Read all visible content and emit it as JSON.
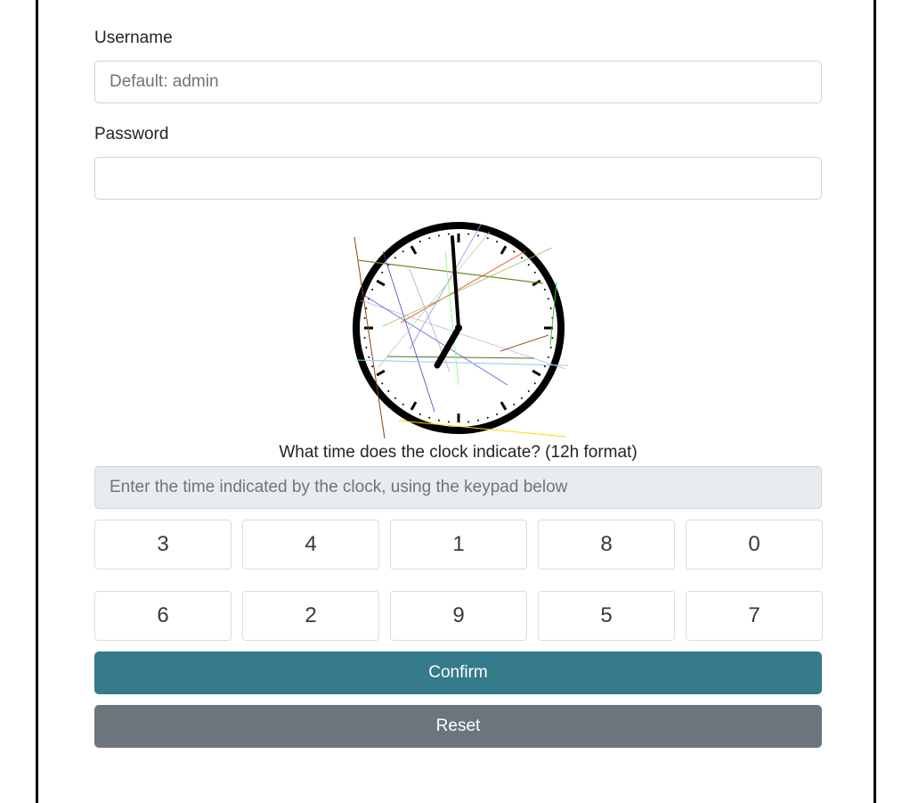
{
  "login": {
    "username_label": "Username",
    "username_placeholder": "Default: admin",
    "username_value": "",
    "password_label": "Password",
    "password_value": ""
  },
  "captcha": {
    "clock_time_shown": "7:00",
    "question": "What time does the clock indicate? (12h format)",
    "answer_placeholder": "Enter the time indicated by the clock, using the keypad below",
    "answer_value": "",
    "keypad_rows": [
      [
        "3",
        "4",
        "1",
        "8",
        "0"
      ],
      [
        "6",
        "2",
        "9",
        "5",
        "7"
      ]
    ]
  },
  "actions": {
    "confirm_label": "Confirm",
    "reset_label": "Reset"
  },
  "colors": {
    "confirm": "#357b8b",
    "reset": "#6c757d",
    "readonly_field": "#e9ecef",
    "clock_noise_lines": [
      "#8b4513",
      "#6b8e23",
      "#e2582a",
      "#8a8fe0",
      "#4040d0",
      "#90ee90",
      "#c0a0d0",
      "#ffd700",
      "#87ceeb",
      "#556b2f",
      "#a0522d",
      "#98fb98"
    ]
  }
}
